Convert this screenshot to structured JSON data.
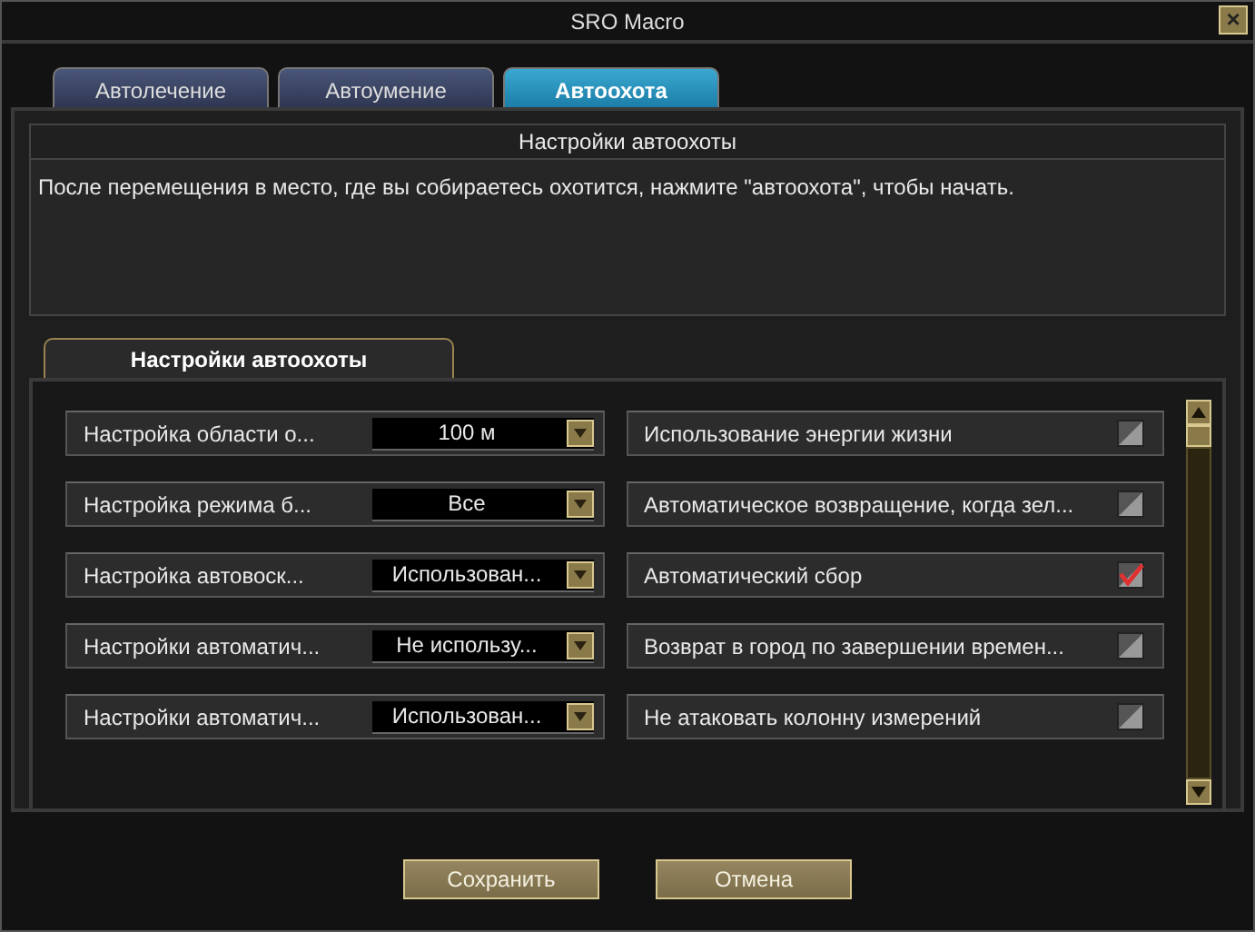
{
  "window": {
    "title": "SRO Macro",
    "close": "×"
  },
  "tabs": [
    {
      "label": "Автолечение",
      "selected": false
    },
    {
      "label": "Автоумение",
      "selected": false
    },
    {
      "label": "Автоохота",
      "selected": true
    }
  ],
  "info": {
    "title": "Настройки автоохоты",
    "text": "После перемещения в место, где вы собираетесь охотится, нажмите \"автоохота\", чтобы начать."
  },
  "section_tab": {
    "label": "Настройки автоохоты",
    "selected": true
  },
  "dropdowns": [
    {
      "label": "Настройка области о...",
      "value": "100 м"
    },
    {
      "label": "Настройка режима б...",
      "value": "Все"
    },
    {
      "label": "Настройка автовоск...",
      "value": "Использован..."
    },
    {
      "label": "Настройки автоматич...",
      "value": "Не использу..."
    },
    {
      "label": "Настройки автоматич...",
      "value": "Использован..."
    }
  ],
  "checkboxes": [
    {
      "label": "Использование энергии жизни",
      "checked": false
    },
    {
      "label": "Автоматическое возвращение, когда зел...",
      "checked": false
    },
    {
      "label": "Автоматический сбор",
      "checked": true
    },
    {
      "label": "Возврат в город по завершении времен...",
      "checked": false
    },
    {
      "label": "Не атаковать колонну измерений",
      "checked": false
    }
  ],
  "buttons": [
    "Сохранить",
    "Отмена"
  ]
}
